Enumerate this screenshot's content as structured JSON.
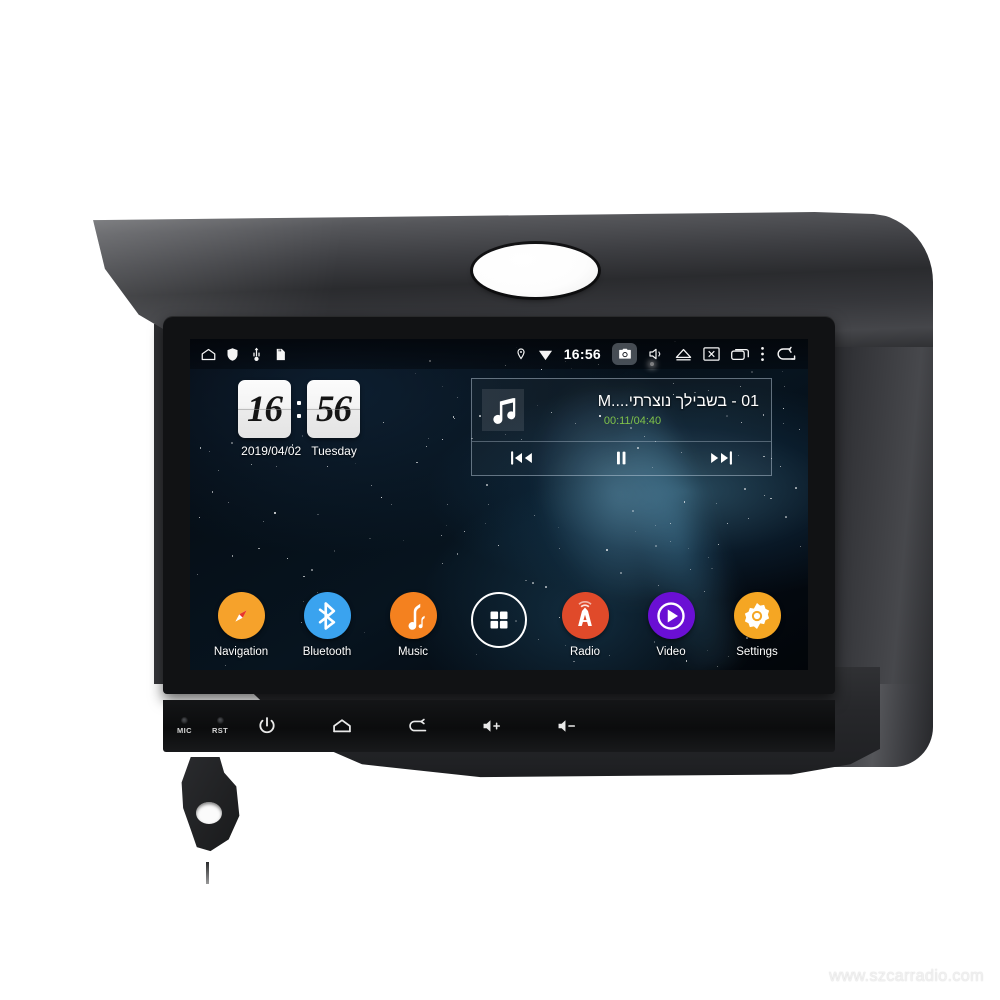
{
  "device": {
    "name": "Android car head unit",
    "watermark": "www.szcarradio.com"
  },
  "statusbar": {
    "left_icons": [
      {
        "name": "home-icon",
        "label": "Home"
      },
      {
        "name": "shield-icon",
        "label": "Shield"
      },
      {
        "name": "usb-icon",
        "label": "USB"
      },
      {
        "name": "sdcard-icon",
        "label": "SD Card"
      }
    ],
    "location_icon": "location-pin-icon",
    "wifi_icon": "wifi-icon",
    "time": "16:56",
    "camera_icon": "camera-icon",
    "mute_icon": "speaker-mute-icon",
    "eject_icon": "eject-icon",
    "screenoff_icon": "screen-off-icon",
    "recents_icon": "recents-icon",
    "overflow_icon": "more-vertical-icon",
    "back_icon": "back-arrow-icon"
  },
  "clock_widget": {
    "hours": "16",
    "minutes": "56",
    "date": "2019/04/02",
    "weekday": "Tuesday"
  },
  "music_widget": {
    "album_icon": "music-note-icon",
    "track_title": "01 - בשבילך נוצרתי....M",
    "elapsed": "00:11",
    "duration": "04:40",
    "time_display": "00:11/04:40",
    "time_color": "#7fc24a",
    "prev_icon": "skip-previous-icon",
    "play_pause_icon": "pause-icon",
    "next_icon": "skip-next-icon"
  },
  "dock": {
    "apps": [
      {
        "label": "Navigation",
        "icon": "compass-icon",
        "color": "#f6a22b"
      },
      {
        "label": "Bluetooth",
        "icon": "bluetooth-icon",
        "color": "#3aa3ef"
      },
      {
        "label": "Music",
        "icon": "music-note-icon",
        "color": "#f4811f"
      },
      {
        "label": "",
        "icon": "app-drawer-icon",
        "color": "transparent"
      },
      {
        "label": "Radio",
        "icon": "radio-tower-icon",
        "color": "#e04a2a"
      },
      {
        "label": "Video",
        "icon": "play-circle-icon",
        "color": "#6a0fd4"
      },
      {
        "label": "Settings",
        "icon": "gear-icon",
        "color": "#f5a623"
      }
    ]
  },
  "hardware_bar": {
    "indicators": [
      {
        "label": "MIC",
        "name": "microphone-hole"
      },
      {
        "label": "RST",
        "name": "reset-hole"
      }
    ],
    "keys": [
      {
        "name": "power-button",
        "icon": "power-icon"
      },
      {
        "name": "home-button",
        "icon": "home-icon"
      },
      {
        "name": "back-button",
        "icon": "back-arrow-icon"
      },
      {
        "name": "volume-up-button",
        "icon": "volume-up-icon"
      },
      {
        "name": "volume-down-button",
        "icon": "volume-down-icon"
      }
    ]
  }
}
